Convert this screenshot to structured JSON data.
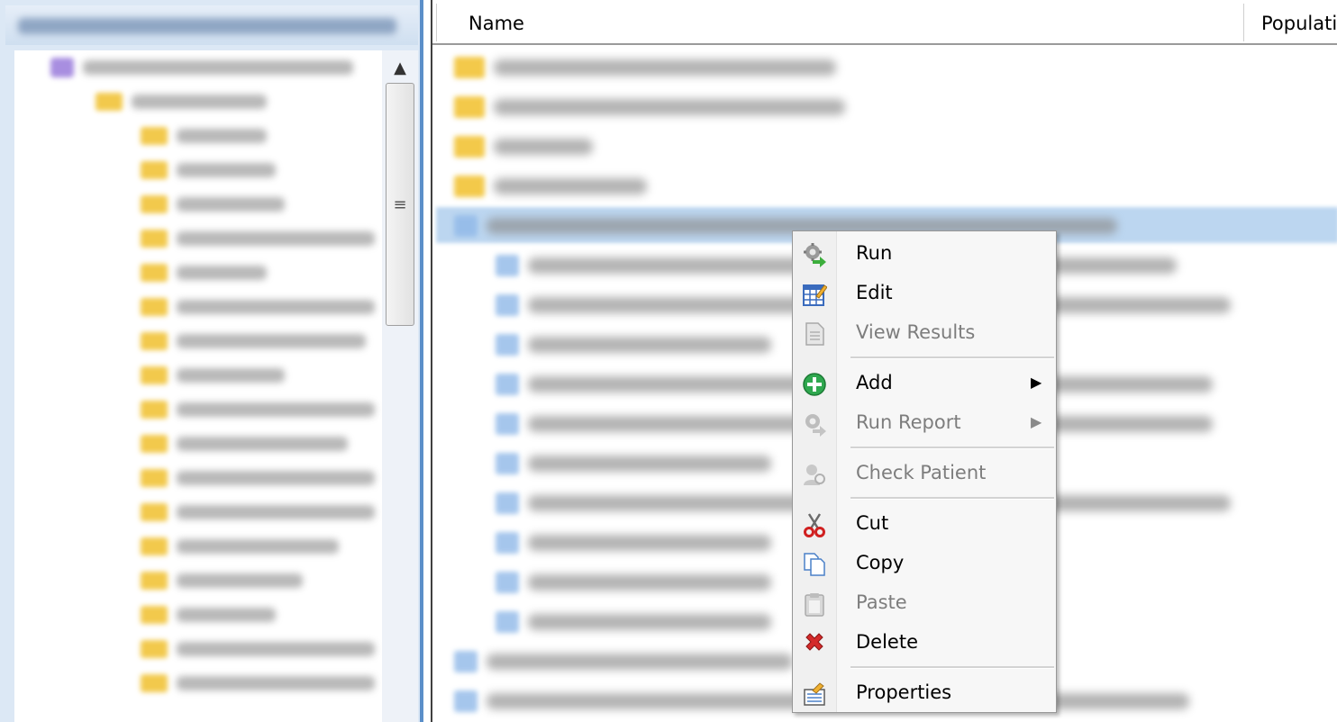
{
  "list": {
    "columns": [
      "Name",
      "Populati"
    ]
  },
  "context_menu": {
    "items": [
      {
        "label": "Run",
        "icon": "gear-run-icon",
        "enabled": true
      },
      {
        "label": "Edit",
        "icon": "edit-table-icon",
        "enabled": true
      },
      {
        "label": "View Results",
        "icon": "document-icon",
        "enabled": false
      },
      {
        "label": "Add",
        "icon": "add-icon",
        "enabled": true,
        "submenu": true
      },
      {
        "label": "Run Report",
        "icon": "gear-report-icon",
        "enabled": false,
        "submenu": true
      },
      {
        "label": "Check Patient",
        "icon": "patient-icon",
        "enabled": false
      },
      {
        "label": "Cut",
        "icon": "scissors-icon",
        "enabled": true
      },
      {
        "label": "Copy",
        "icon": "copy-icon",
        "enabled": true
      },
      {
        "label": "Paste",
        "icon": "paste-icon",
        "enabled": false
      },
      {
        "label": "Delete",
        "icon": "delete-icon",
        "enabled": true
      },
      {
        "label": "Properties",
        "icon": "properties-icon",
        "enabled": true
      }
    ],
    "submenu_arrow": "▶"
  },
  "scrollbar": {
    "up_arrow": "▲",
    "grip": "≡"
  },
  "colors": {
    "accent": "#5b8fc9",
    "selection": "#bcd6f0",
    "folder": "#f3c94a",
    "disabled_text": "#7d7d7d"
  }
}
